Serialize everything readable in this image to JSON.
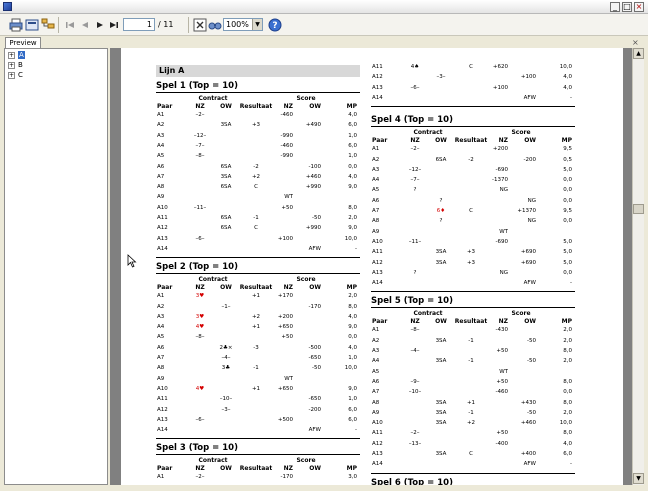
{
  "window": {
    "title": ""
  },
  "toolbar": {
    "page_value": "1",
    "page_total": "/ 11",
    "zoom": "100%"
  },
  "tabs": [
    {
      "label": "Preview"
    }
  ],
  "tree": {
    "items": [
      "A",
      "B",
      "C"
    ]
  },
  "report": {
    "heading": "Lijn A",
    "col_headers": {
      "paar": "Paar",
      "contract": "Contract",
      "nz": "NZ",
      "ow": "OW",
      "resultaat": "Resultaat",
      "score": "Score",
      "snz": "NZ",
      "sow": "OW",
      "mp": "MP"
    },
    "left_sections": [
      {
        "title": "Spel 1 (Top = 10)",
        "rows": [
          [
            "A1",
            "–2–",
            "",
            "",
            "-460",
            "",
            "4,0"
          ],
          [
            "A2",
            "",
            "3SA",
            "+3",
            "",
            "+490",
            "6,0"
          ],
          [
            "A3",
            "–12–",
            "",
            "",
            "-990",
            "",
            "1,0"
          ],
          [
            "A4",
            "–7–",
            "",
            "",
            "-460",
            "",
            "6,0"
          ],
          [
            "A5",
            "–8–",
            "",
            "",
            "-990",
            "",
            "1,0"
          ],
          [
            "A6",
            "",
            "6SA",
            "-2",
            "",
            "-100",
            "0,0"
          ],
          [
            "A7",
            "",
            "3SA",
            "+2",
            "",
            "+460",
            "4,0"
          ],
          [
            "A8",
            "",
            "6SA",
            "C",
            "",
            "+990",
            "9,0"
          ],
          [
            "A9",
            "",
            "",
            "",
            "WT",
            "",
            ""
          ],
          [
            "A10",
            "–11–",
            "",
            "",
            "+50",
            "",
            "8,0"
          ],
          [
            "A11",
            "",
            "6SA",
            "-1",
            "",
            "-50",
            "2,0"
          ],
          [
            "A12",
            "",
            "6SA",
            "C",
            "",
            "+990",
            "9,0"
          ],
          [
            "A13",
            "–6–",
            "",
            "",
            "+100",
            "",
            "10,0"
          ],
          [
            "A14",
            "",
            "",
            "",
            "",
            "AFW",
            "-"
          ]
        ]
      },
      {
        "title": "Spel 2 (Top = 10)",
        "rows": [
          [
            "A1",
            "3♥",
            "",
            "+1",
            "+170",
            "",
            "2,0"
          ],
          [
            "A2",
            "",
            "–1–",
            "",
            "",
            "-170",
            "8,0"
          ],
          [
            "A3",
            "3♥",
            "",
            "+2",
            "+200",
            "",
            "4,0"
          ],
          [
            "A4",
            "4♥",
            "",
            "+1",
            "+650",
            "",
            "9,0"
          ],
          [
            "A5",
            "–8–",
            "",
            "",
            "+50",
            "",
            "0,0"
          ],
          [
            "A6",
            "",
            "2♣×",
            "-3",
            "",
            "-500",
            "4,0"
          ],
          [
            "A7",
            "",
            "–4–",
            "",
            "",
            "-650",
            "1,0"
          ],
          [
            "A8",
            "",
            "3♣",
            "-1",
            "",
            "-50",
            "10,0"
          ],
          [
            "A9",
            "",
            "",
            "",
            "WT",
            "",
            ""
          ],
          [
            "A10",
            "4♥",
            "",
            "+1",
            "+650",
            "",
            "9,0"
          ],
          [
            "A11",
            "",
            "–10–",
            "",
            "",
            "-650",
            "1,0"
          ],
          [
            "A12",
            "",
            "–3–",
            "",
            "",
            "-200",
            "6,0"
          ],
          [
            "A13",
            "–6–",
            "",
            "",
            "+500",
            "",
            "6,0"
          ],
          [
            "A14",
            "",
            "",
            "",
            "",
            "AFW",
            "-"
          ]
        ]
      },
      {
        "title": "Spel 3 (Top = 10)",
        "rows": [
          [
            "A1",
            "–2–",
            "",
            "",
            "-170",
            "",
            "3,0"
          ]
        ]
      }
    ],
    "right_top_rows": [
      [
        "A11",
        "4♠",
        "",
        "C",
        "+620",
        "",
        "10,0"
      ],
      [
        "A12",
        "",
        "–3–",
        "",
        "",
        "+100",
        "4,0"
      ],
      [
        "A13",
        "–6–",
        "",
        "",
        "+100",
        "",
        "4,0"
      ],
      [
        "A14",
        "",
        "",
        "",
        "",
        "AFW",
        "-"
      ]
    ],
    "right_sections": [
      {
        "title": "Spel 4 (Top = 10)",
        "rows": [
          [
            "A1",
            "–2–",
            "",
            "",
            "+200",
            "",
            "9,5"
          ],
          [
            "A2",
            "",
            "6SA",
            "-2",
            "",
            "-200",
            "0,5"
          ],
          [
            "A3",
            "–12–",
            "",
            "",
            "-690",
            "",
            "5,0"
          ],
          [
            "A4",
            "–7–",
            "",
            "",
            "-1370",
            "",
            "0,0"
          ],
          [
            "A5",
            "?",
            "",
            "",
            "NG",
            "",
            "0,0"
          ],
          [
            "A6",
            "",
            "?",
            "",
            "",
            "NG",
            "0,0"
          ],
          [
            "A7",
            "",
            "6♦",
            "C",
            "",
            "+1370",
            "9,5"
          ],
          [
            "A8",
            "",
            "?",
            "",
            "",
            "NG",
            "0,0"
          ],
          [
            "A9",
            "",
            "",
            "",
            "WT",
            "",
            ""
          ],
          [
            "A10",
            "–11–",
            "",
            "",
            "-690",
            "",
            "5,0"
          ],
          [
            "A11",
            "",
            "3SA",
            "+3",
            "",
            "+690",
            "5,0"
          ],
          [
            "A12",
            "",
            "3SA",
            "+3",
            "",
            "+690",
            "5,0"
          ],
          [
            "A13",
            "?",
            "",
            "",
            "NG",
            "",
            "0,0"
          ],
          [
            "A14",
            "",
            "",
            "",
            "",
            "AFW",
            "-"
          ]
        ]
      },
      {
        "title": "Spel 5 (Top = 10)",
        "rows": [
          [
            "A1",
            "–8–",
            "",
            "",
            "-430",
            "",
            "2,0"
          ],
          [
            "A2",
            "",
            "3SA",
            "-1",
            "",
            "-50",
            "2,0"
          ],
          [
            "A3",
            "–4–",
            "",
            "",
            "+50",
            "",
            "8,0"
          ],
          [
            "A4",
            "",
            "3SA",
            "-1",
            "",
            "-50",
            "2,0"
          ],
          [
            "A5",
            "",
            "",
            "",
            "WT",
            "",
            ""
          ],
          [
            "A6",
            "–9–",
            "",
            "",
            "+50",
            "",
            "8,0"
          ],
          [
            "A7",
            "–10–",
            "",
            "",
            "-460",
            "",
            "0,0"
          ],
          [
            "A8",
            "",
            "3SA",
            "+1",
            "",
            "+430",
            "8,0"
          ],
          [
            "A9",
            "",
            "3SA",
            "-1",
            "",
            "-50",
            "2,0"
          ],
          [
            "A10",
            "",
            "3SA",
            "+2",
            "",
            "+460",
            "10,0"
          ],
          [
            "A11",
            "–2–",
            "",
            "",
            "+50",
            "",
            "8,0"
          ],
          [
            "A12",
            "–13–",
            "",
            "",
            "-400",
            "",
            "4,0"
          ],
          [
            "A13",
            "",
            "3SA",
            "C",
            "",
            "+400",
            "6,0"
          ],
          [
            "A14",
            "",
            "",
            "",
            "",
            "AFW",
            "-"
          ]
        ]
      },
      {
        "title": "Spel 6 (Top = 10)",
        "rows": []
      }
    ]
  }
}
